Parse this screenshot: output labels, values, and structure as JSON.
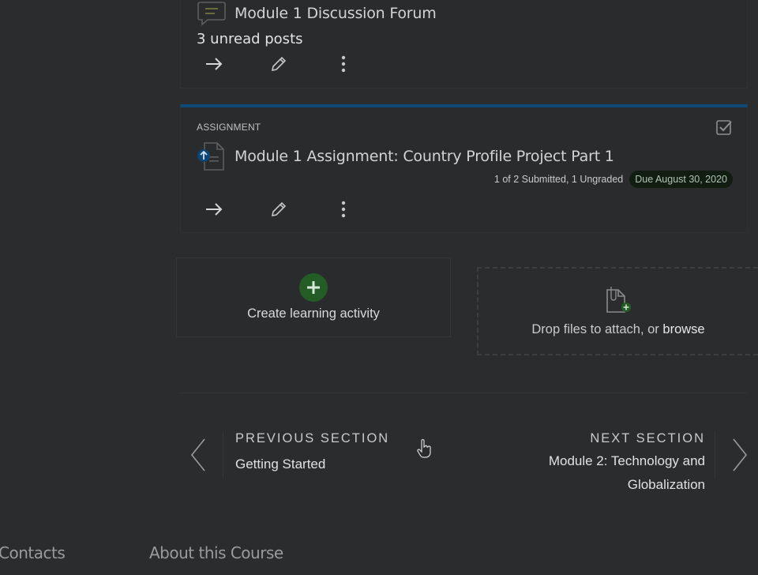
{
  "discussion": {
    "title": "Module 1 Discussion Forum",
    "unread": "3 unread posts"
  },
  "assignment": {
    "type_label": "ASSIGNMENT",
    "title": "Module 1 Assignment: Country Profile Project Part 1",
    "submitted": "1 of 2 Submitted, 1 Ungraded",
    "due": "Due August 30, 2020"
  },
  "create": {
    "label": "Create learning activity"
  },
  "drop": {
    "text": "Drop files to attach, or",
    "browse": "browse"
  },
  "nav": {
    "prev_heading": "PREVIOUS SECTION",
    "prev_name": "Getting Started",
    "next_heading": "NEXT SECTION",
    "next_name_line1": "Module 2: Technology and",
    "next_name_line2": "Globalization"
  },
  "footer": {
    "contacts": "Contacts",
    "about": "About this Course"
  },
  "colors": {
    "overlay_bg": "#2b2c2d",
    "accent_blue": "#0e4a7a",
    "green": "#245c26",
    "due_badge_bg": "#101d10"
  }
}
